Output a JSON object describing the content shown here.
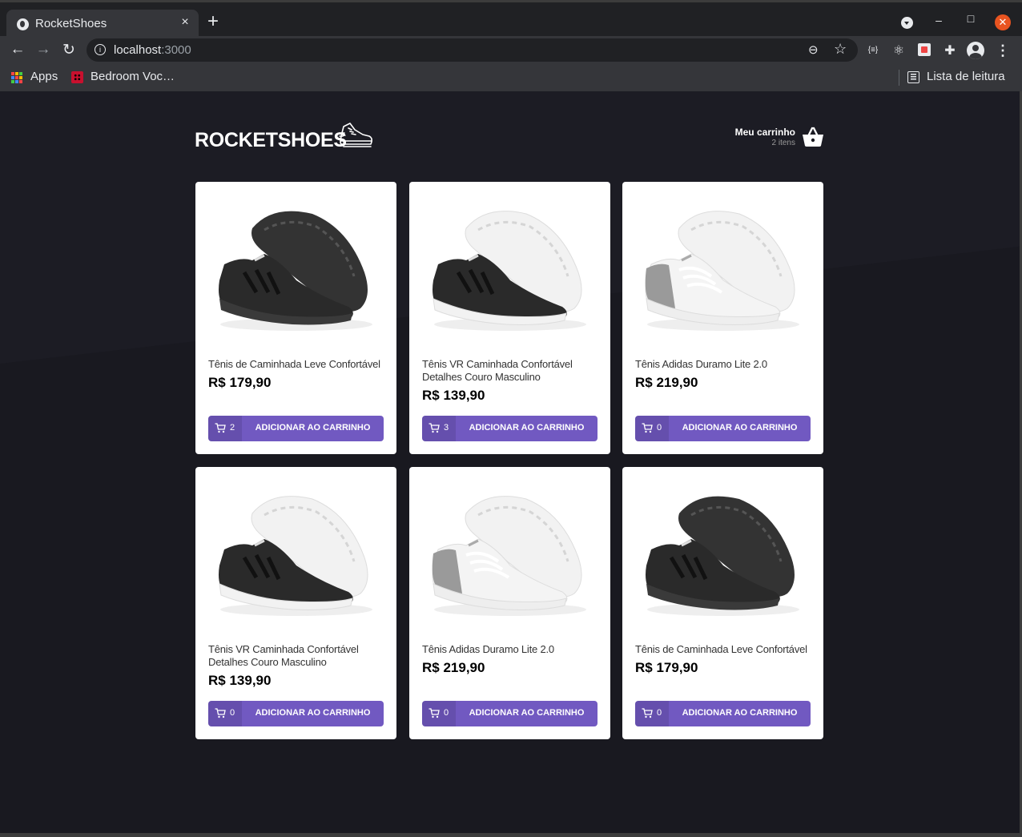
{
  "browser": {
    "tab_title": "RocketShoes",
    "tab_close": "×",
    "new_tab": "+",
    "url_host": "localhost",
    "url_port": ":3000",
    "bookmarks": [
      {
        "label": "Apps",
        "icon": "apps-grid-icon"
      },
      {
        "label": "Bedroom Voc…",
        "icon": "bedroom-favicon-icon"
      }
    ],
    "reading_list": "Lista de leitura",
    "window_controls": {
      "minimize": "–",
      "maximize": "□",
      "close": "✕"
    }
  },
  "header": {
    "logo": "ROCKETSHOES",
    "cart_label": "Meu carrinho",
    "cart_count": "2 itens"
  },
  "products": [
    {
      "name": "Tênis de Caminhada Leve Confortável",
      "price": "R$ 179,90",
      "qty": "2",
      "button": "ADICIONAR AO CARRINHO",
      "shoe": "black-black",
      "colors": {
        "upper": "#2a2a2a",
        "sole": "#3a3a3a"
      }
    },
    {
      "name": "Tênis VR Caminhada Confortável Detalhes Couro Masculino",
      "price": "R$ 139,90",
      "qty": "3",
      "button": "ADICIONAR AO CARRINHO",
      "shoe": "black-white",
      "colors": {
        "upper": "#2a2a2a",
        "sole": "#f2f2f2"
      }
    },
    {
      "name": "Tênis Adidas Duramo Lite 2.0",
      "price": "R$ 219,90",
      "qty": "0",
      "button": "ADICIONAR AO CARRINHO",
      "shoe": "white-grey",
      "colors": {
        "upper": "#f4f4f4",
        "sole": "#eeeeee"
      }
    },
    {
      "name": "Tênis VR Caminhada Confortável Detalhes Couro Masculino",
      "price": "R$ 139,90",
      "qty": "0",
      "button": "ADICIONAR AO CARRINHO",
      "shoe": "black-white",
      "colors": {
        "upper": "#2a2a2a",
        "sole": "#f2f2f2"
      }
    },
    {
      "name": "Tênis Adidas Duramo Lite 2.0",
      "price": "R$ 219,90",
      "qty": "0",
      "button": "ADICIONAR AO CARRINHO",
      "shoe": "white-grey",
      "colors": {
        "upper": "#f4f4f4",
        "sole": "#eeeeee"
      }
    },
    {
      "name": "Tênis de Caminhada Leve Confortável",
      "price": "R$ 179,90",
      "qty": "0",
      "button": "ADICIONAR AO CARRINHO",
      "shoe": "black-black",
      "colors": {
        "upper": "#2a2a2a",
        "sole": "#3a3a3a"
      }
    }
  ],
  "colors": {
    "accent": "#7159c1",
    "page_bg": "#191920",
    "card_bg": "#ffffff"
  }
}
